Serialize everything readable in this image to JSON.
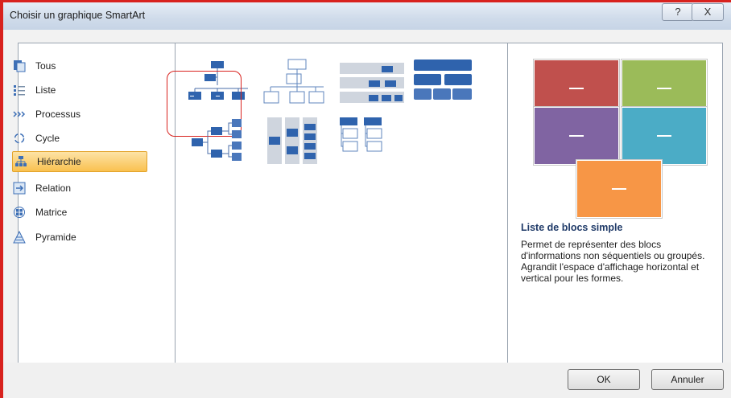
{
  "dialog": {
    "title": "Choisir un graphique SmartArt",
    "help_label": "?",
    "close_label": "X"
  },
  "categories": [
    {
      "label": "Tous",
      "icon": "all-icon"
    },
    {
      "label": "Liste",
      "icon": "list-icon"
    },
    {
      "label": "Processus",
      "icon": "process-icon"
    },
    {
      "label": "Cycle",
      "icon": "cycle-icon"
    },
    {
      "label": "Hiérarchie",
      "icon": "hierarchy-icon",
      "selected": true
    },
    {
      "label": "Relation",
      "icon": "relationship-icon"
    },
    {
      "label": "Matrice",
      "icon": "matrix-icon"
    },
    {
      "label": "Pyramide",
      "icon": "pyramid-icon"
    }
  ],
  "preview": {
    "title": "Liste de blocs simple",
    "description": "Permet de représenter des blocs d'informations non séquentiels ou groupés. Agrandit l'espace d'affichage horizontal et vertical pour les formes.",
    "colors": [
      "#c0504d",
      "#9bbb59",
      "#8064a2",
      "#4bacc6",
      "#f79646"
    ]
  },
  "buttons": {
    "ok": "OK",
    "cancel": "Annuler"
  }
}
